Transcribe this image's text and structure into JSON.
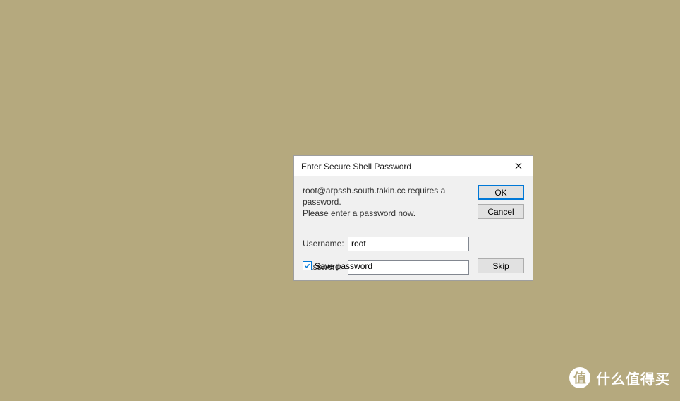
{
  "dialog": {
    "title": "Enter Secure Shell Password",
    "message_line1": "root@arpssh.south.takin.cc requires a password.",
    "message_line2": "Please enter a password now.",
    "username_label": "Username:",
    "username_value": "root",
    "password_label": "Password:",
    "password_value": "",
    "save_password_label": "Save password",
    "save_password_checked": true,
    "buttons": {
      "ok": "OK",
      "cancel": "Cancel",
      "skip": "Skip"
    }
  },
  "watermark": {
    "icon_char": "值",
    "text": "什么值得买"
  }
}
